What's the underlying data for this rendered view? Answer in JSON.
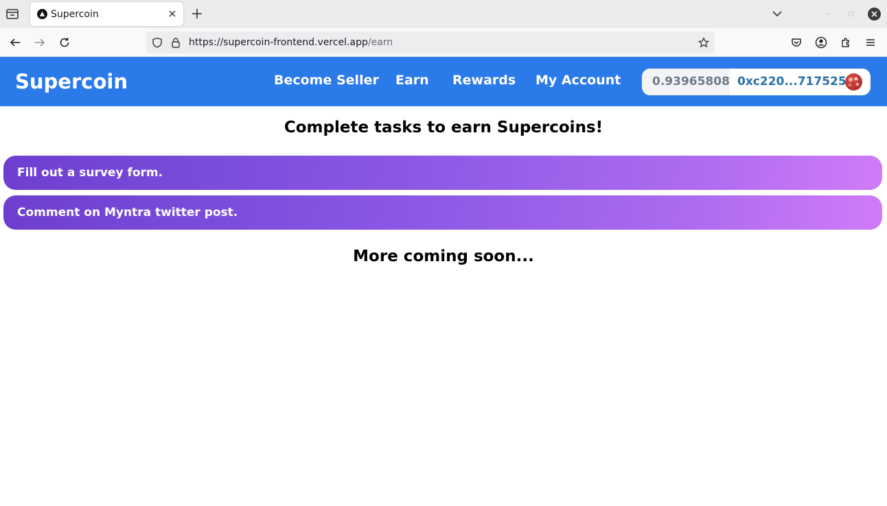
{
  "browser": {
    "tab_title": "Supercoin",
    "url_host": "https://supercoin-frontend.vercel.app",
    "url_path": "/earn"
  },
  "header": {
    "brand": "Supercoin",
    "nav": [
      "Become Seller",
      "Earn",
      "Rewards",
      "My Account"
    ],
    "wallet": {
      "balance": "0.93965808",
      "address": "0xc220...717525"
    }
  },
  "main": {
    "title": "Complete tasks to earn Supercoins!",
    "tasks": [
      "Fill out a survey form.",
      "Comment on Myntra twitter post."
    ],
    "footer_note": "More coming soon..."
  },
  "colors": {
    "header_bg": "#2b7ae9",
    "task_gradient_start": "#6e3fcf",
    "task_gradient_end": "#d07cf9",
    "address_text": "#2a6fa8"
  }
}
